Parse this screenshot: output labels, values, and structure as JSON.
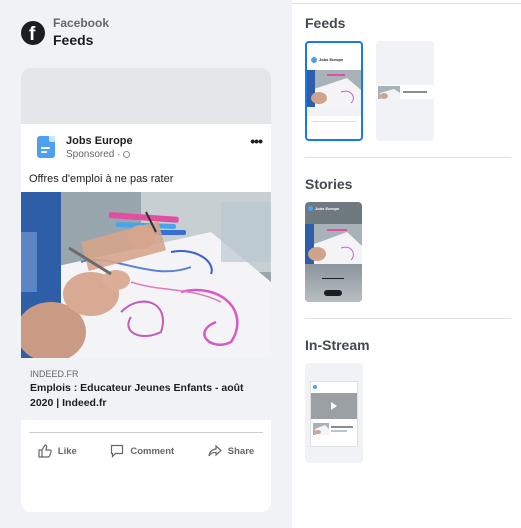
{
  "platform": {
    "name": "Facebook",
    "placement": "Feeds",
    "logo_letter": "f"
  },
  "post": {
    "page_name": "Jobs Europe",
    "sponsored_label": "Sponsored",
    "separator": "·",
    "primary_text": "Offres d'emploi à ne pas rater",
    "domain": "INDEED.FR",
    "headline": "Emplois : Educateur Jeunes Enfants - août 2020 | Indeed.fr",
    "actions": [
      {
        "label": "Like",
        "icon": "thumbs-up-icon"
      },
      {
        "label": "Comment",
        "icon": "comment-icon"
      },
      {
        "label": "Share",
        "icon": "share-icon"
      }
    ]
  },
  "placements": {
    "feeds_title": "Feeds",
    "stories_title": "Stories",
    "instream_title": "In-Stream",
    "feeds_mini_page": "Jobs Europe",
    "stories_mini_page": "Jobs Europe"
  },
  "colors": {
    "accent": "#1877f2",
    "panel_bg": "#f0f2f5",
    "text_primary": "#1c1e21",
    "text_secondary": "#65676b"
  }
}
